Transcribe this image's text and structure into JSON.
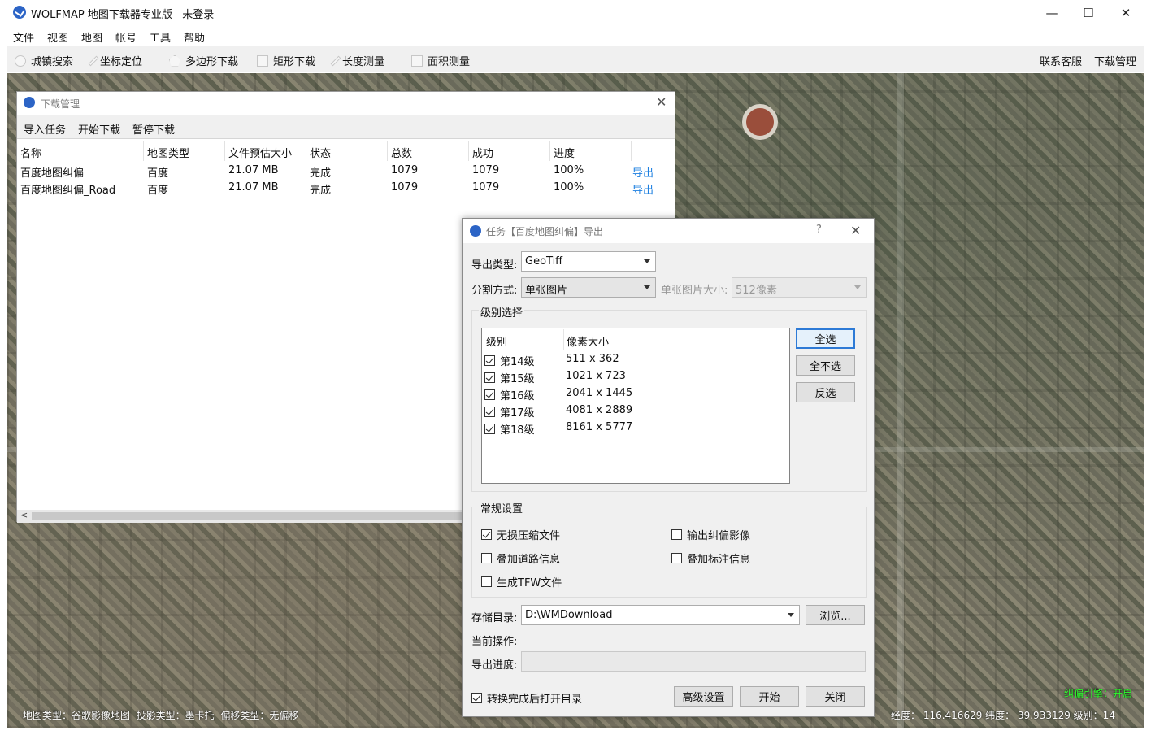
{
  "window": {
    "title": "WOLFMAP 地图下载器专业版",
    "login_status": "未登录"
  },
  "window_controls": {
    "minimize": "—",
    "maximize": "☐",
    "close": "✕"
  },
  "menu": [
    "文件",
    "视图",
    "地图",
    "帐号",
    "工具",
    "帮助"
  ],
  "toolbar": {
    "tools": [
      "城镇搜索",
      "坐标定位",
      "多边形下载",
      "矩形下载",
      "长度测量",
      "面积测量"
    ],
    "right": [
      "联系客服",
      "下载管理"
    ]
  },
  "download_manager": {
    "title": "下载管理",
    "close": "✕",
    "menu": [
      "导入任务",
      "开始下载",
      "暂停下载"
    ],
    "columns": [
      "名称",
      "地图类型",
      "文件预估大小",
      "状态",
      "总数",
      "成功",
      "进度"
    ],
    "rows": [
      {
        "name": "百度地图纠偏",
        "type": "百度",
        "size": "21.07 MB",
        "status": "完成",
        "total": "1079",
        "success": "1079",
        "progress": "100%",
        "action": "导出"
      },
      {
        "name": "百度地图纠偏_Road",
        "type": "百度",
        "size": "21.07 MB",
        "status": "完成",
        "total": "1079",
        "success": "1079",
        "progress": "100%",
        "action": "导出"
      }
    ],
    "scroll_left": "<"
  },
  "export_dialog": {
    "title": "任务【百度地图纠偏】导出",
    "help": "?",
    "close": "✕",
    "export_type_label": "导出类型:",
    "export_type_value": "GeoTiff",
    "split_label": "分割方式:",
    "split_value": "单张图片",
    "tile_size_label": "单张图片大小:",
    "tile_size_value": "512像素",
    "level_group_title": "级别选择",
    "level_columns": [
      "级别",
      "像素大小"
    ],
    "levels": [
      {
        "level": "第14级",
        "pixels": "511 x 362",
        "checked": true
      },
      {
        "level": "第15级",
        "pixels": "1021 x 723",
        "checked": true
      },
      {
        "level": "第16级",
        "pixels": "2041 x 1445",
        "checked": true
      },
      {
        "level": "第17级",
        "pixels": "4081 x 2889",
        "checked": true
      },
      {
        "level": "第18级",
        "pixels": "8161 x 5777",
        "checked": true
      }
    ],
    "select_all": "全选",
    "select_none": "全不选",
    "invert": "反选",
    "general_group_title": "常规设置",
    "options": [
      {
        "label": "无损压缩文件",
        "checked": true
      },
      {
        "label": "输出纠偏影像",
        "checked": false
      },
      {
        "label": "叠加道路信息",
        "checked": false
      },
      {
        "label": "叠加标注信息",
        "checked": false
      },
      {
        "label": "生成TFW文件",
        "checked": false
      }
    ],
    "save_dir_label": "存储目录:",
    "save_dir_value": "D:\\WMDownload",
    "browse": "浏览...",
    "current_op_label": "当前操作:",
    "progress_label": "导出进度:",
    "open_dir_after": {
      "label": "转换完成后打开目录",
      "checked": true
    },
    "advanced": "高级设置",
    "start": "开始",
    "close_button": "关闭"
  },
  "status": {
    "map_type": "地图类型：谷歌影像地图",
    "projection": "投影类型：墨卡托",
    "offset": "偏移类型：无偏移",
    "engine": "纠偏引擎：开启",
    "coords": "经度： 116.416629  纬度： 39.933129  级别：14"
  },
  "colors": {
    "accent": "#2c64c6",
    "link": "#1e80e0",
    "engine_text": "#2dff2d"
  }
}
